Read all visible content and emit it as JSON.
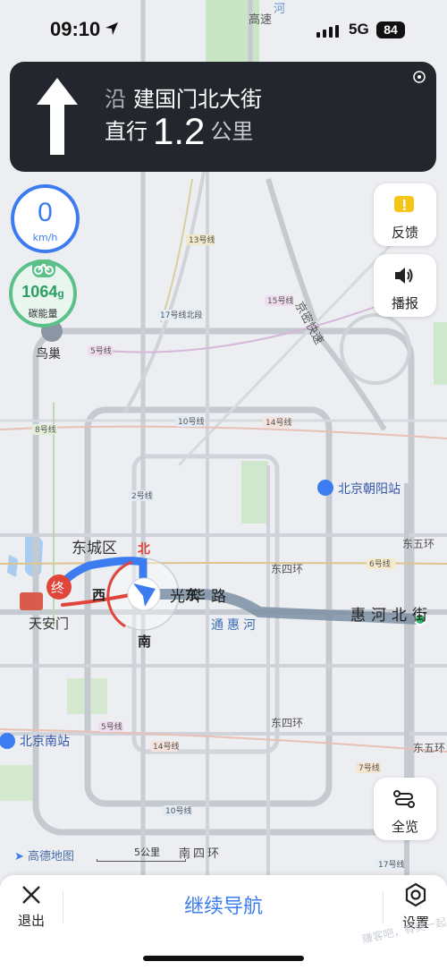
{
  "status_bar": {
    "time": "09:10",
    "network": "5G",
    "battery": "84"
  },
  "nav": {
    "prefix": "沿",
    "road": "建国门北大街",
    "action": "直行",
    "distance": "1.2",
    "unit": "公里"
  },
  "speed": {
    "value": "0",
    "unit": "km/h"
  },
  "energy": {
    "value": "1064",
    "unit_suffix": "g",
    "label": "碳能量"
  },
  "side_buttons": {
    "feedback": "反馈",
    "broadcast": "播报",
    "overview": "全览"
  },
  "bottom": {
    "exit": "退出",
    "continue": "继续导航",
    "settings": "设置"
  },
  "map": {
    "attribution": "高德地图",
    "scale": "5公里",
    "labels": {
      "niaochao": "鸟巢",
      "dongcheng": "东城区",
      "tiananmen": "天安门",
      "beijing_chaoyang": "北京朝阳站",
      "beijing_nan": "北京南站",
      "guanghua": "光华路",
      "tonghuihe": "通惠河",
      "huihebei": "惠河北街",
      "nansihuan": "南四环",
      "jingmi": "京密快速",
      "gaosu": "高速",
      "dongsihuan_1": "东四环",
      "dongsihuan_2": "东四环",
      "dongwuhuan_1": "东五环",
      "dongwuhuan_2": "东五环",
      "compass_n": "北",
      "compass_w": "西",
      "compass_s": "南",
      "compass_e": "东",
      "end": "终",
      "he": "河"
    },
    "lines": {
      "l13": "13号线",
      "l15": "15号线",
      "l17a": "17号线北段",
      "l5a": "5号线",
      "l8": "8号线",
      "l10a": "10号线",
      "l14a": "14号线",
      "l2": "2号线",
      "l6": "6号线",
      "l5b": "5号线",
      "l14b": "14号线",
      "l7": "7号线",
      "l10b": "10号线",
      "l17b": "17号线"
    }
  },
  "watermark": "赚客吧，有奖一起",
  "colors": {
    "accent": "#3d7cf0",
    "route_blue": "#3d7cf0",
    "route_gray": "#7b8fa3",
    "energy_green": "#5cc08a",
    "nav_bg": "#23272d",
    "end_red": "#e0443a"
  }
}
